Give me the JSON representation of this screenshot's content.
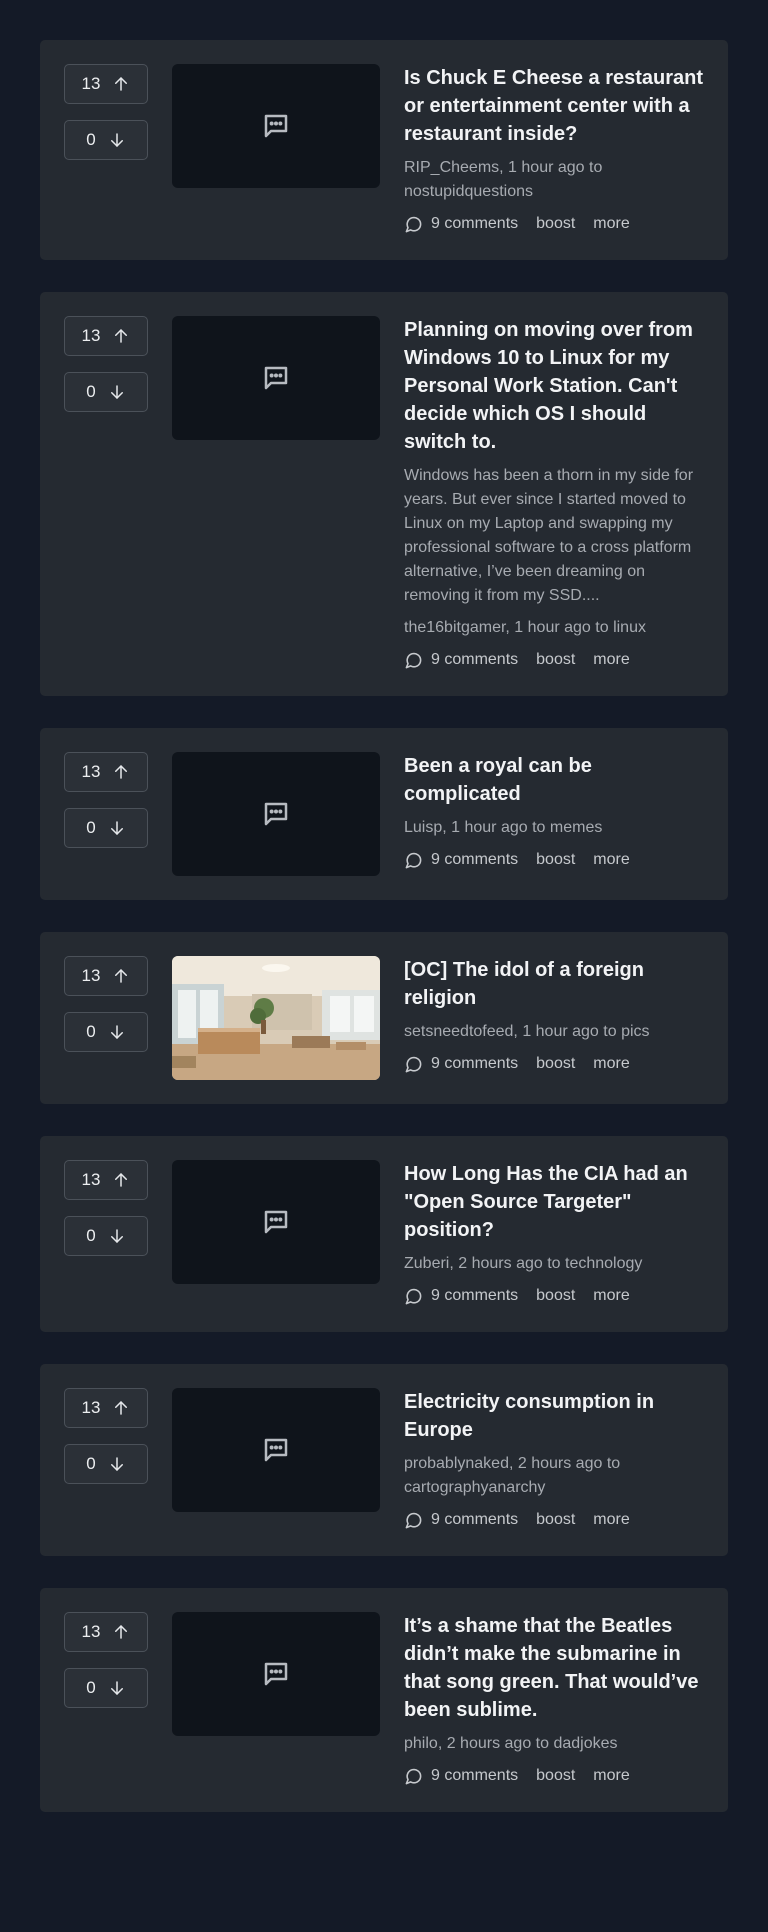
{
  "posts": [
    {
      "upvotes": "13",
      "downvotes": "0",
      "title": "Is Chuck E Cheese a restaurant or entertainment center with a restaurant inside?",
      "body": "",
      "author": "RIP_Cheems",
      "time": "1 hour ago",
      "to": "to",
      "community": "nostupidquestions",
      "comments": "9 comments",
      "boost": "boost",
      "more": "more",
      "thumb_icon": "message-icon"
    },
    {
      "upvotes": "13",
      "downvotes": "0",
      "title": "Planning on moving over from Windows 10 to Linux for my Personal Work Station. Can't decide which OS I should switch to.",
      "body": "Windows has been a thorn in my side for years. But ever since I started moved to Linux on my Laptop and swapping my professional software to a cross platform alternative, I’ve been dreaming on removing it from my SSD....",
      "author": "the16bitgamer",
      "time": "1 hour ago",
      "to": "to",
      "community": "linux",
      "comments": "9 comments",
      "boost": "boost",
      "more": "more",
      "thumb_icon": "message-icon"
    },
    {
      "upvotes": "13",
      "downvotes": "0",
      "title": "Been a royal can be complicated",
      "body": "",
      "author": "Luisp",
      "time": "1 hour ago",
      "to": "to",
      "community": "memes",
      "comments": "9 comments",
      "boost": "boost",
      "more": "more",
      "thumb_icon": "message-icon"
    },
    {
      "upvotes": "13",
      "downvotes": "0",
      "title": "[OC] The idol of a foreign religion",
      "body": "",
      "author": "setsneedtofeed",
      "time": "1 hour ago",
      "to": "to",
      "community": "pics",
      "comments": "9 comments",
      "boost": "boost",
      "more": "more",
      "thumb_icon": "photo-office-interior"
    },
    {
      "upvotes": "13",
      "downvotes": "0",
      "title": "How Long Has the CIA had an \"Open Source Targeter\" position?",
      "body": "",
      "author": "Zuberi",
      "time": "2 hours ago",
      "to": "to",
      "community": "technology",
      "comments": "9 comments",
      "boost": "boost",
      "more": "more",
      "thumb_icon": "message-icon"
    },
    {
      "upvotes": "13",
      "downvotes": "0",
      "title": "Electricity consumption in Europe",
      "body": "",
      "author": "probablynaked",
      "time": "2 hours ago",
      "to": "to",
      "community": "cartographyanarchy",
      "comments": "9 comments",
      "boost": "boost",
      "more": "more",
      "thumb_icon": "message-icon"
    },
    {
      "upvotes": "13",
      "downvotes": "0",
      "title": "It’s a shame that the Beatles didn’t make the submarine in that song green. That would’ve been sublime.",
      "body": "",
      "author": "philo",
      "time": "2 hours ago",
      "to": "to",
      "community": "dadjokes",
      "comments": "9 comments",
      "boost": "boost",
      "more": "more",
      "thumb_icon": "message-icon"
    }
  ],
  "colors": {
    "page_bg": "#141a27",
    "card_bg": "#252a31",
    "thumb_bg": "#0f141b",
    "muted_text": "#a7abb1"
  }
}
